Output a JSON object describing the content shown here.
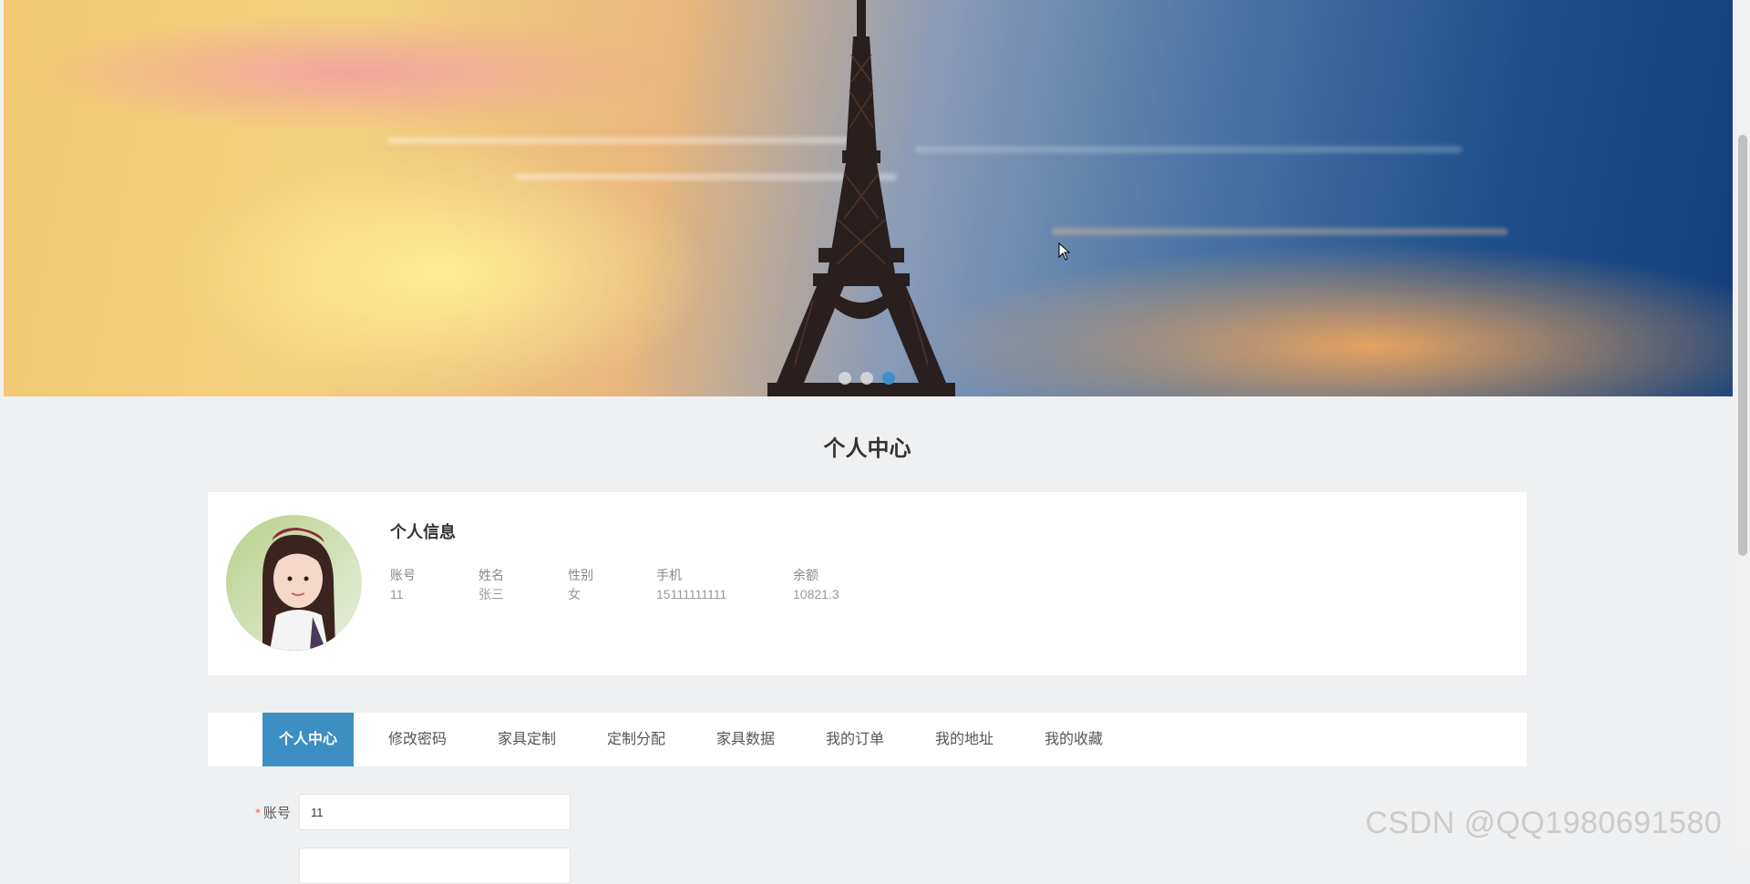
{
  "banner": {
    "slides_count": 3,
    "active_slide": 3
  },
  "page": {
    "title": "个人中心"
  },
  "profile": {
    "section_title": "个人信息",
    "fields": [
      {
        "label": "账号",
        "value": "11"
      },
      {
        "label": "姓名",
        "value": "张三"
      },
      {
        "label": "性别",
        "value": "女"
      },
      {
        "label": "手机",
        "value": "15111111111"
      },
      {
        "label": "余额",
        "value": "10821.3"
      }
    ]
  },
  "tabs": [
    {
      "label": "个人中心",
      "active": true
    },
    {
      "label": "修改密码",
      "active": false
    },
    {
      "label": "家具定制",
      "active": false
    },
    {
      "label": "定制分配",
      "active": false
    },
    {
      "label": "家具数据",
      "active": false
    },
    {
      "label": "我的订单",
      "active": false
    },
    {
      "label": "我的地址",
      "active": false
    },
    {
      "label": "我的收藏",
      "active": false
    }
  ],
  "form": {
    "account_label": "账号",
    "account_required_mark": "*",
    "account_value": "11"
  },
  "watermark": "CSDN @QQ1980691580",
  "colors": {
    "accent": "#3d8fc3",
    "background": "#eff0f2",
    "required": "#f56c6c"
  }
}
